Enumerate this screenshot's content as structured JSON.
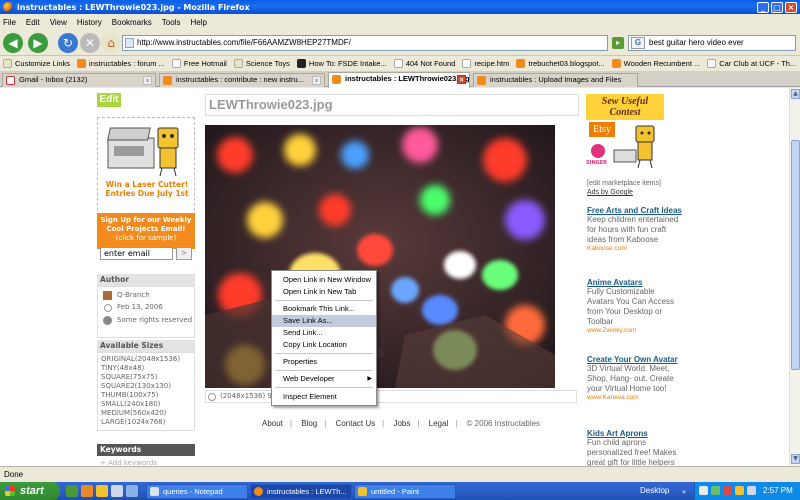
{
  "window": {
    "title": "instructables : LEWThrowie023.jpg - Mozilla Firefox",
    "minimize": "_",
    "maximize": "□",
    "close": "×"
  },
  "menu": [
    "File",
    "Edit",
    "View",
    "History",
    "Bookmarks",
    "Tools",
    "Help"
  ],
  "nav": {
    "url": "http://www.instructables.com/file/F66AAMZW8HEP27TMDF/",
    "search_value": "best guitar hero video ever",
    "search_engine_letter": "G"
  },
  "bookmarks": [
    {
      "label": "Customize Links",
      "color": "#e9e4c8"
    },
    {
      "label": "instructables : forum ...",
      "color": "#f28b1c"
    },
    {
      "label": "Free Hotmail",
      "color": "#ffffff"
    },
    {
      "label": "Science Toys",
      "color": "#e9e4c8"
    },
    {
      "label": "How To: FSDE Intake...",
      "color": "#222222"
    },
    {
      "label": "404 Not Found",
      "color": "#ffffff"
    },
    {
      "label": "recipe.htm",
      "color": "#ffffff"
    },
    {
      "label": "trebuchet03.blogspot...",
      "color": "#f28b1c"
    },
    {
      "label": "Wooden Recumbent ...",
      "color": "#f28b1c"
    },
    {
      "label": "Car Club at UCF - Th...",
      "color": "#ffffff"
    }
  ],
  "tabs": [
    {
      "label": "Gmail - Inbox (2132)",
      "active": false
    },
    {
      "label": "instructables : contribute : new instru...",
      "active": false
    },
    {
      "label": "instructables : LEWThrowie023.jpg",
      "active": true
    },
    {
      "label": "instructables : Upload Images and Files",
      "active": false
    }
  ],
  "page": {
    "edit_label": "Edit",
    "file_title": "LEWThrowie023.jpg",
    "promo": {
      "line1": "Win a Laser Cutter!",
      "line2": "Entries Due July 1st"
    },
    "signup": {
      "line1": "Sign Up for our Weekly",
      "line2": "Cool Projects Email!",
      "line3": "(click for sample)"
    },
    "email_value": "enter email",
    "email_go": ">",
    "author": {
      "heading": "Author",
      "name": "Q-Branch",
      "date": "Feb 13, 2006",
      "license": "Some rights reserved"
    },
    "sizes": {
      "heading": "Available Sizes",
      "items": [
        "ORIGINAL(2048x1536)",
        "TINY(48x48)",
        "SQUARE(75x75)",
        "SQUARE2(130x130)",
        "THUMB(100x75)",
        "SMALL(240x180)",
        "MEDIUM(560x420)",
        "LARGE(1024x768)"
      ]
    },
    "keywords": {
      "heading": "Keywords",
      "add": "+ Add keywords"
    },
    "caption": "(2048x1536) 98",
    "footer": {
      "links": [
        "About",
        "Blog",
        "Contact Us",
        "Jobs",
        "Legal"
      ],
      "copyright": "© 2006 Instructables"
    },
    "contest": {
      "line1": "Sew Useful",
      "line2": "Contest",
      "etsy": "Etsy",
      "singer": "SINGER"
    },
    "ads": {
      "edit_link": "[edit marketplace items]",
      "by_google": "Ads by Google",
      "items": [
        {
          "title": "Free Arts and Craft Ideas",
          "body": "Keep children entertained for hours with fun craft ideas from Kaboose",
          "url": "Kaboose.com"
        },
        {
          "title": "Anime Avatars",
          "body": "Fully Customizable Avatars You Can Access from Your Desktop or Toolbar",
          "url": "www.Zwinky.com"
        },
        {
          "title": "Create Your Own Avatar",
          "body": "3D Virtual World. Meet, Shop, Hang- out. Create your Virtual Home too!",
          "url": "www.Kaneva.com"
        },
        {
          "title": "Kids Art Aprons",
          "body": "Fun child aprons personalized free! Makes great gift for little helpers",
          "url": ""
        }
      ]
    }
  },
  "context_menu": {
    "items": [
      "Open Link in New Window",
      "Open Link in New Tab",
      "Bookmark This Link...",
      "Save Link As...",
      "Send Link...",
      "Copy Link Location",
      "Properties",
      "Web Developer",
      "Inspect Element"
    ],
    "highlighted": "Save Link As...",
    "submenu_arrow": "▶"
  },
  "status": "Done",
  "taskbar": {
    "start": "start",
    "buttons": [
      {
        "label": "queries - Notepad",
        "active": false
      },
      {
        "label": "instructables : LEWTh...",
        "active": true
      },
      {
        "label": "untitled - Paint",
        "active": false
      }
    ],
    "desktop_label": "Desktop",
    "time": "2:57 PM"
  }
}
